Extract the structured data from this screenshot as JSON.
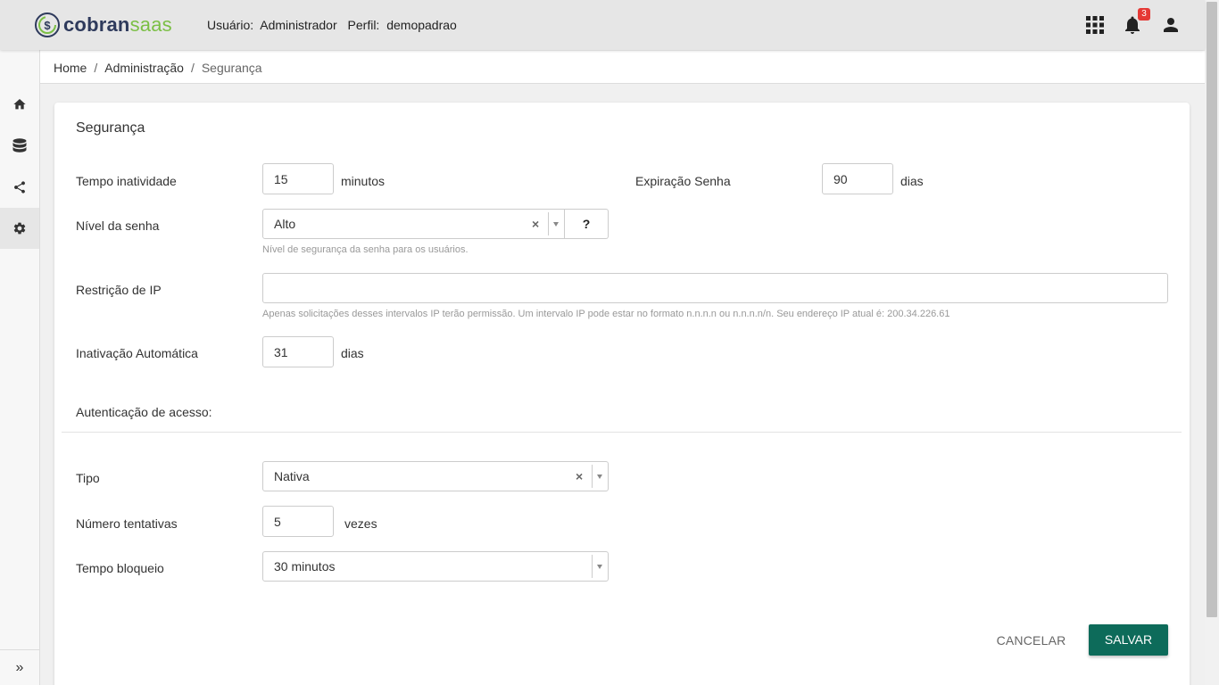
{
  "header": {
    "logo": {
      "part1": "cobran",
      "part2": "saas"
    },
    "user_label": "Usuário:",
    "user_value": "Administrador",
    "profile_label": "Perfil:",
    "profile_value": "demopadrao",
    "notifications_count": "3",
    "icons": [
      "apps-grid-icon",
      "bell-icon",
      "user-icon"
    ]
  },
  "sidebar": {
    "items": [
      "home-icon",
      "database-icon",
      "share-icon",
      "gear-icon"
    ],
    "active": "gear-icon",
    "expand_icon": "»"
  },
  "breadcrumb": {
    "items": [
      "Home",
      "Administração"
    ],
    "separator": "/",
    "current": "Segurança"
  },
  "form": {
    "title": "Segurança",
    "tempo_inatividade": {
      "label": "Tempo inatividade",
      "value": "15",
      "suffix": "minutos"
    },
    "expiracao_senha": {
      "label": "Expiração Senha",
      "value": "90",
      "suffix": "dias"
    },
    "nivel_senha": {
      "label": "Nível da senha",
      "selected": "Alto",
      "clear": "×",
      "help_button": "?",
      "help": "Nível de segurança da senha para os usuários."
    },
    "restricao_ip": {
      "label": "Restrição de IP",
      "value": "",
      "help": "Apenas solicitações desses intervalos IP terão permissão. Um intervalo IP pode estar no formato n.n.n.n ou n.n.n.n/n. Seu endereço IP atual é: 200.34.226.61"
    },
    "inativacao_automatica": {
      "label": "Inativação Automática",
      "value": "31",
      "suffix": "dias"
    },
    "autenticacao_section": "Autenticação de acesso:",
    "tipo": {
      "label": "Tipo",
      "selected": "Nativa",
      "clear": "×"
    },
    "numero_tentativas": {
      "label": "Número tentativas",
      "value": "5",
      "suffix": "vezes"
    },
    "tempo_bloqueio": {
      "label": "Tempo bloqueio",
      "selected": "30 minutos"
    },
    "cancel_label": "CANCELAR",
    "save_label": "SALVAR"
  },
  "colors": {
    "primary": "#0d6b5a",
    "brand_dark": "#2e3a5c",
    "brand_green": "#7bbf45",
    "badge": "#e53935"
  }
}
